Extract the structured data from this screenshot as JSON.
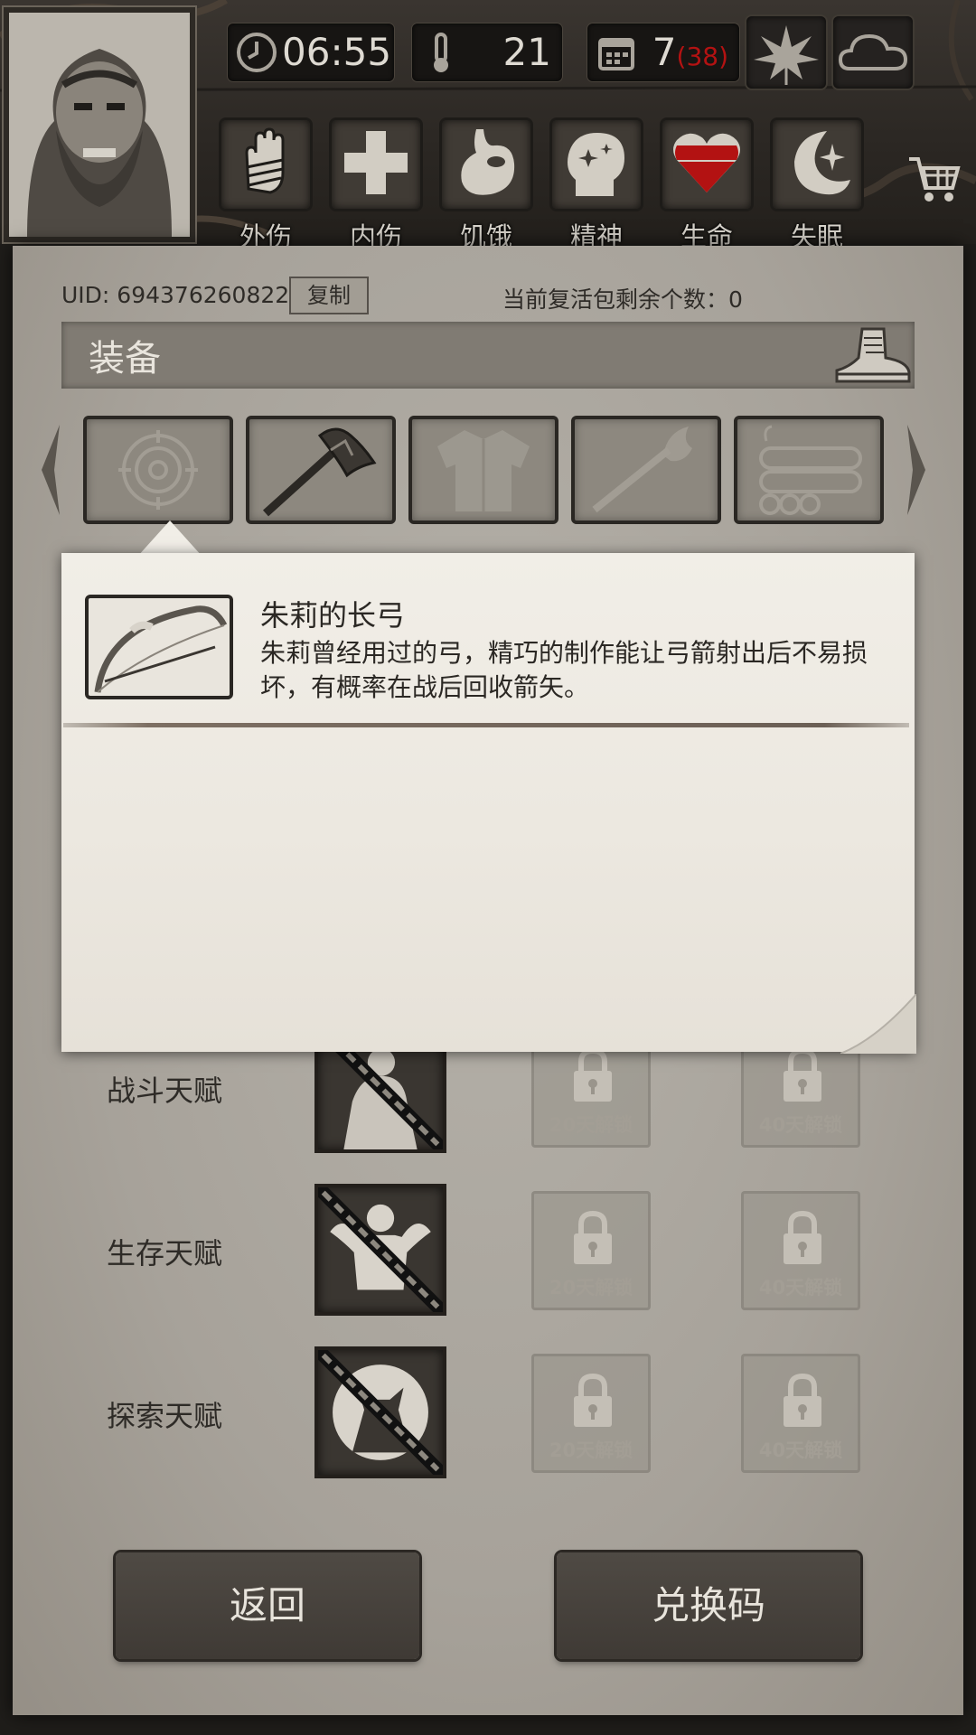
{
  "top_stats": {
    "time": "06:55",
    "temperature": "21",
    "day": "7",
    "day_extra": "(38)"
  },
  "status_bar": [
    {
      "label": "外伤",
      "icon": "bandaged-hand-icon"
    },
    {
      "label": "内伤",
      "icon": "cross-icon"
    },
    {
      "label": "饥饿",
      "icon": "stomach-icon"
    },
    {
      "label": "精神",
      "icon": "head-sparkle-icon"
    },
    {
      "label": "生命",
      "icon": "heart-icon"
    },
    {
      "label": "失眠",
      "icon": "moon-star-icon"
    }
  ],
  "account": {
    "uid_label": "UID: 694376260822",
    "copy_label": "复制",
    "revive_label": "当前复活包剩余个数：0"
  },
  "equipment": {
    "title": "装备",
    "slots": [
      {
        "icon": "target-icon",
        "equipped": false
      },
      {
        "icon": "axe-icon",
        "equipped": true
      },
      {
        "icon": "shirt-icon",
        "equipped": false
      },
      {
        "icon": "torch-icon",
        "equipped": false
      },
      {
        "icon": "logs-icon",
        "equipped": false
      }
    ]
  },
  "tooltip": {
    "item_name": "朱莉的长弓",
    "item_desc": "朱莉曾经用过的弓，精巧的制作能让弓箭射出后不易损坏，有概率在战后回收箭矢。",
    "item_icon": "longbow-icon"
  },
  "talents": {
    "rows": [
      {
        "label": "战斗天赋",
        "lock_20": "20天解锁",
        "lock_40": "40天解锁"
      },
      {
        "label": "生存天赋",
        "lock_20": "20天解锁",
        "lock_40": "40天解锁"
      },
      {
        "label": "探索天赋",
        "lock_20": "20天解锁",
        "lock_40": "40天解锁"
      }
    ]
  },
  "buttons": {
    "back": "返回",
    "redeem": "兑换码"
  },
  "colors": {
    "panel": "#a7a29a",
    "tooltip_bg": "#ece8e0",
    "life_red": "#b31212",
    "dark_wood": "#2b2723"
  }
}
